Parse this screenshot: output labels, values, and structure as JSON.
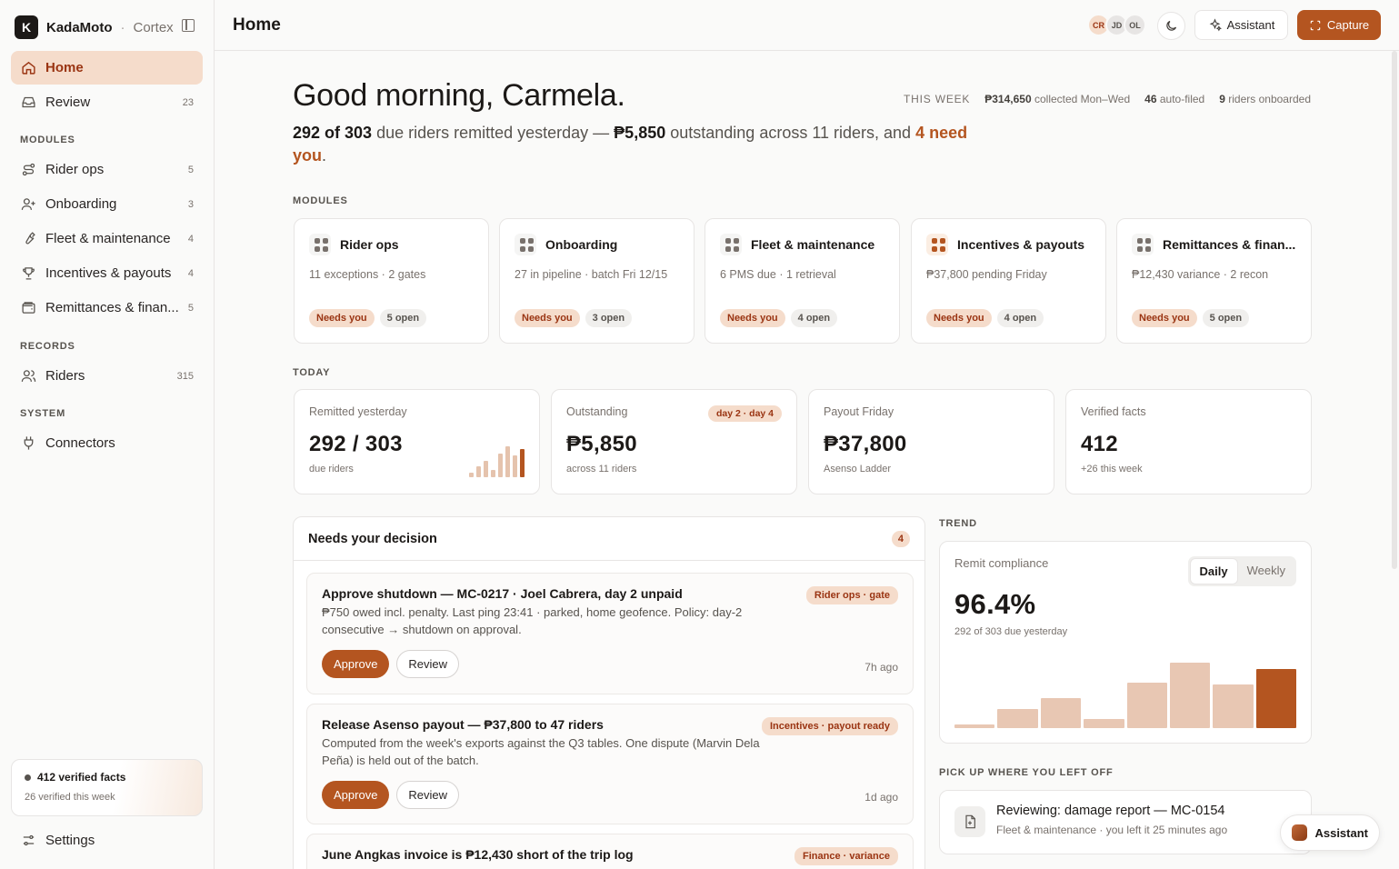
{
  "brand": {
    "logo_letter": "K",
    "name": "KadaMoto",
    "sep": "·",
    "sub": "Cortex"
  },
  "sidebar": {
    "home": "Home",
    "review": {
      "label": "Review",
      "count": "23"
    },
    "modules_title": "MODULES",
    "modules": [
      {
        "label": "Rider ops",
        "count": "5",
        "icon": "route-icon"
      },
      {
        "label": "Onboarding",
        "count": "3",
        "icon": "user-plus-icon"
      },
      {
        "label": "Fleet & maintenance",
        "count": "4",
        "icon": "wrench-icon"
      },
      {
        "label": "Incentives & payouts",
        "count": "4",
        "icon": "trophy-icon"
      },
      {
        "label": "Remittances & finan...",
        "count": "5",
        "icon": "wallet-icon"
      }
    ],
    "records_title": "RECORDS",
    "riders": {
      "label": "Riders",
      "count": "315"
    },
    "system_title": "SYSTEM",
    "connectors": "Connectors",
    "facts": {
      "title": "412 verified facts",
      "sub": "26 verified this week"
    },
    "settings": "Settings"
  },
  "topbar": {
    "title": "Home",
    "avatars": [
      "CR",
      "JD",
      "OL"
    ],
    "assistant": "Assistant",
    "capture": "Capture"
  },
  "greeting": "Good morning, Carmela.",
  "week": {
    "label": "THIS WEEK",
    "collected_amt": "₱314,650",
    "collected_txt": "collected Mon–Wed",
    "autofiled_n": "46",
    "autofiled_txt": "auto-filed",
    "onboarded_n": "9",
    "onboarded_txt": "riders onboarded"
  },
  "summary": {
    "a": "292 of 303",
    "b": " due riders remitted yesterday — ",
    "c": "₱5,850",
    "d": " outstanding across 11 riders, and ",
    "e": "4 need you",
    "f": "."
  },
  "modules_title": "MODULES",
  "modules": [
    {
      "name": "Rider ops",
      "desc": "11 exceptions · 2 gates",
      "need": "Needs you",
      "open": "5 open"
    },
    {
      "name": "Onboarding",
      "desc": "27 in pipeline · batch Fri 12/15",
      "need": "Needs you",
      "open": "3 open"
    },
    {
      "name": "Fleet & maintenance",
      "desc": "6 PMS due · 1 retrieval",
      "need": "Needs you",
      "open": "4 open"
    },
    {
      "name": "Incentives & payouts",
      "desc": "₱37,800 pending Friday",
      "need": "Needs you",
      "open": "4 open"
    },
    {
      "name": "Remittances & finan...",
      "desc": "₱12,430 variance · 2 recon",
      "need": "Needs you",
      "open": "5 open"
    }
  ],
  "today_title": "TODAY",
  "kpis": [
    {
      "label": "Remitted yesterday",
      "value": "292 / 303",
      "sub": "due riders"
    },
    {
      "label": "Outstanding",
      "value": "₱5,850",
      "sub": "across 11 riders",
      "badge": "day 2 · day 4"
    },
    {
      "label": "Payout Friday",
      "value": "₱37,800",
      "sub": "Asenso Ladder"
    },
    {
      "label": "Verified facts",
      "value": "412",
      "sub": "+26 this week"
    }
  ],
  "decision": {
    "title": "Needs your decision",
    "count": "4",
    "items": [
      {
        "title": "Approve shutdown — MC-0217 · Joel Cabrera, day 2 unpaid",
        "body": "₱750 owed incl. penalty. Last ping 23:41 · parked, home geofence. Policy: day-2 consecutive → shutdown on approval.",
        "tag": "Rider ops · gate",
        "approve": "Approve",
        "review": "Review",
        "time": "7h ago"
      },
      {
        "title": "Release Asenso payout — ₱37,800 to 47 riders",
        "body": "Computed from the week's exports against the Q3 tables. One dispute (Marvin Dela Peña) is held out of the batch.",
        "tag": "Incentives · payout ready",
        "approve": "Approve",
        "review": "Review",
        "time": "1d ago"
      },
      {
        "title": "June Angkas invoice is ₱12,430 short of the trip log",
        "tag": "Finance · variance"
      }
    ]
  },
  "trend_title": "TREND",
  "trend": {
    "label": "Remit compliance",
    "daily": "Daily",
    "weekly": "Weekly",
    "value": "96.4%",
    "sub": "292 of 303 due yesterday"
  },
  "pickup_title": "PICK UP WHERE YOU LEFT OFF",
  "pickup": {
    "title": "Reviewing: damage report — MC-0154",
    "sub": "Fleet & maintenance · you left it 25 minutes ago"
  },
  "float_assistant": "Assistant",
  "colors": {
    "accent": "#b45520",
    "accent_soft": "#f5dccb"
  }
}
